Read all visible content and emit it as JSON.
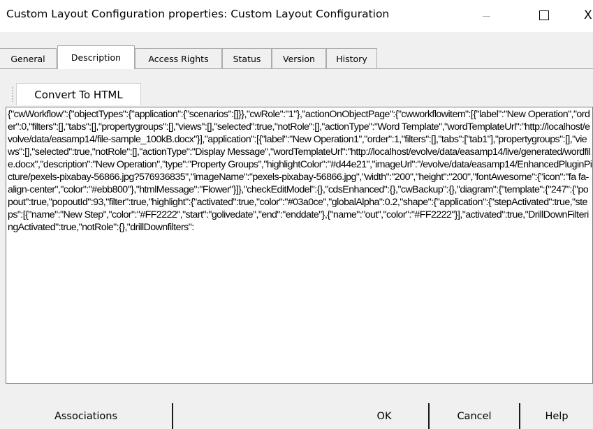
{
  "window": {
    "title": "Custom Layout Configuration properties: Custom Layout Configuration",
    "minimize_glyph": "—",
    "close_glyph": "X"
  },
  "tabs": [
    {
      "label": "General",
      "active": false
    },
    {
      "label": "Description",
      "active": true
    },
    {
      "label": "Access Rights",
      "active": false
    },
    {
      "label": "Status",
      "active": false
    },
    {
      "label": "Version",
      "active": false
    },
    {
      "label": "History",
      "active": false
    }
  ],
  "toolbar": {
    "convert_label": "Convert To HTML"
  },
  "description": {
    "content": "{\"cwWorkflow\":{\"objectTypes\":{\"application\":{\"scenarios\":[]}},\"cwRole\":\"1\"},\"actionOnObjectPage\":{\"cwworkflowitem\":[{\"label\":\"New Operation\",\"order\":0,\"filters\":[],\"tabs\":[],\"propertygroups\":[],\"views\":[],\"selected\":true,\"notRole\":[],\"actionType\":\"Word Template\",\"wordTemplateUrl\":\"http://localhost/evolve/data/easamp14/file-sample_100kB.docx\"}],\"application\":[{\"label\":\"New Operation1\",\"order\":1,\"filters\":[],\"tabs\":[\"tab1\"],\"propertygroups\":[],\"views\":[],\"selected\":true,\"notRole\":[],\"actionType\":\"Display Message\",\"wordTemplateUrl\":\"http://localhost/evolve/data/easamp14/live/generated/wordfile.docx\",\"description\":\"New Operation\",\"type\":\"Property Groups\",\"highlightColor\":\"#d44e21\",\"imageUrl\":\"/evolve/data/easamp14/EnhancedPluginPicture/pexels-pixabay-56866.jpg?576936835\",\"imageName\":\"pexels-pixabay-56866.jpg\",\"width\":\"200\",\"height\":\"200\",\"fontAwesome\":{\"icon\":\"fa fa-align-center\",\"color\":\"#ebb800\"},\"htmlMessage\":\"Flower\"}]},\"checkEditModel\":{},\"cdsEnhanced\":{},\"cwBackup\":{},\"diagram\":{\"template\":{\"247\":{\"popout\":true,\"popoutId\":93,\"filter\":true,\"highlight\":{\"activated\":true,\"color\":\"#03a0ce\",\"globalAlpha\":0.2,\"shape\":{\"application\":{\"stepActivated\":true,\"steps\":[{\"name\":\"New Step\",\"color\":\"#FF2222\",\"start\":\"golivedate\",\"end\":\"enddate\"},{\"name\":\"out\",\"color\":\"#FF2222\"}],\"activated\":true,\"DrillDownFilteringActivated\":true,\"notRole\":{},\"drillDownfilters\":"
  },
  "buttons": {
    "associations": "Associations",
    "ok": "OK",
    "cancel": "Cancel",
    "help": "Help"
  }
}
